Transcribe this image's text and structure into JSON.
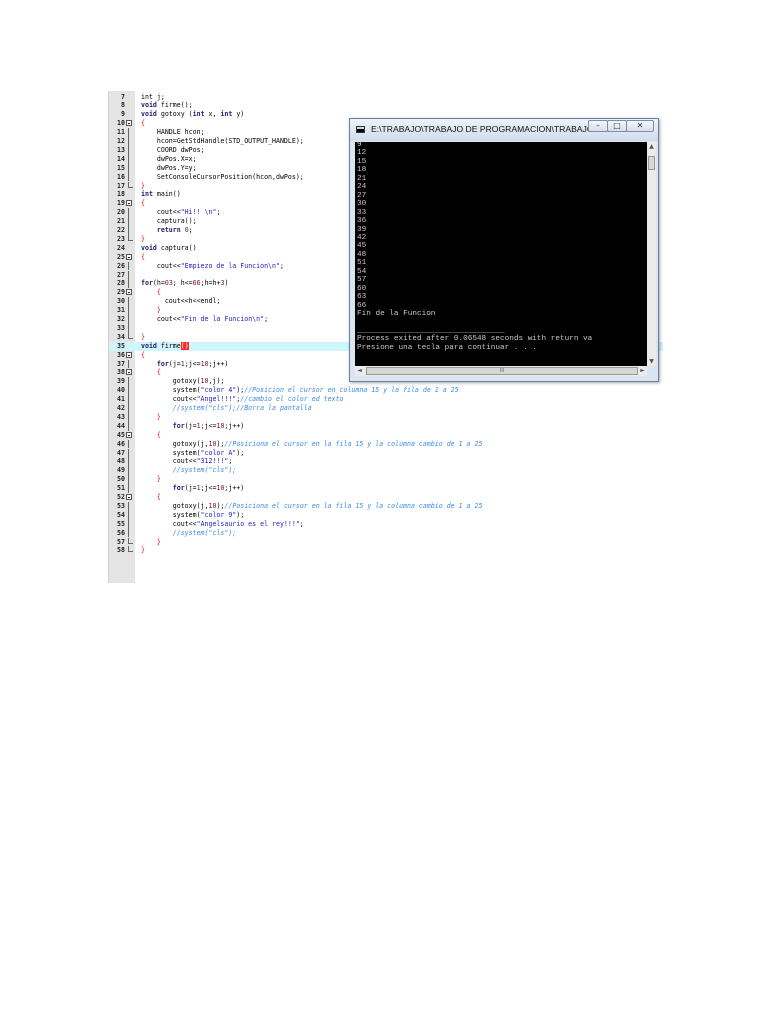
{
  "editor": {
    "lines": [
      {
        "n": "7",
        "g": "",
        "hl": false,
        "t": [
          [
            "n",
            "int j;"
          ]
        ]
      },
      {
        "n": "8",
        "g": "",
        "hl": false,
        "t": [
          [
            "k",
            "void"
          ],
          [
            "n",
            " firme();"
          ]
        ]
      },
      {
        "n": "9",
        "g": "",
        "hl": false,
        "t": [
          [
            "k",
            "void"
          ],
          [
            "n",
            " gotoxy ("
          ],
          [
            "k",
            "int"
          ],
          [
            "n",
            " x, "
          ],
          [
            "k",
            "int"
          ],
          [
            "n",
            " y)"
          ]
        ]
      },
      {
        "n": "10",
        "g": "f",
        "hl": false,
        "t": [
          [
            "r",
            "{"
          ]
        ]
      },
      {
        "n": "11",
        "g": "l",
        "hl": false,
        "t": [
          [
            "n",
            "    HANDLE hcon;"
          ]
        ]
      },
      {
        "n": "12",
        "g": "l",
        "hl": false,
        "t": [
          [
            "n",
            "    hcon=GetStdHandle(STD_OUTPUT_HANDLE);"
          ]
        ]
      },
      {
        "n": "13",
        "g": "l",
        "hl": false,
        "t": [
          [
            "n",
            "    COORD dwPos;"
          ]
        ]
      },
      {
        "n": "14",
        "g": "l",
        "hl": false,
        "t": [
          [
            "n",
            "    dwPos.X=x;"
          ]
        ]
      },
      {
        "n": "15",
        "g": "l",
        "hl": false,
        "t": [
          [
            "n",
            "    dwPos.Y=y;"
          ]
        ]
      },
      {
        "n": "16",
        "g": "l",
        "hl": false,
        "t": [
          [
            "n",
            "    SetConsoleCursorPosition(hcon,dwPos);"
          ]
        ]
      },
      {
        "n": "17",
        "g": "e",
        "hl": false,
        "t": [
          [
            "r",
            "}"
          ]
        ]
      },
      {
        "n": "18",
        "g": "",
        "hl": false,
        "t": [
          [
            "k",
            "int"
          ],
          [
            "n",
            " main()"
          ]
        ]
      },
      {
        "n": "19",
        "g": "f",
        "hl": false,
        "t": [
          [
            "r",
            "{"
          ]
        ]
      },
      {
        "n": "20",
        "g": "l",
        "hl": false,
        "t": [
          [
            "n",
            "    cout<<"
          ],
          [
            "s",
            "\"Hi!! \\n\""
          ],
          [
            "n",
            ";"
          ]
        ]
      },
      {
        "n": "21",
        "g": "l",
        "hl": false,
        "t": [
          [
            "n",
            "    captura();"
          ]
        ]
      },
      {
        "n": "22",
        "g": "l",
        "hl": false,
        "t": [
          [
            "k",
            "    return"
          ],
          [
            "n",
            " "
          ],
          [
            "m",
            "0"
          ],
          [
            "n",
            ";"
          ]
        ]
      },
      {
        "n": "23",
        "g": "e",
        "hl": false,
        "t": [
          [
            "r",
            "}"
          ]
        ]
      },
      {
        "n": "24",
        "g": "",
        "hl": false,
        "t": [
          [
            "k",
            "void"
          ],
          [
            "n",
            " captura()"
          ]
        ]
      },
      {
        "n": "25",
        "g": "f",
        "hl": false,
        "t": [
          [
            "r",
            "{"
          ]
        ]
      },
      {
        "n": "26",
        "g": "l",
        "hl": false,
        "t": [
          [
            "n",
            "    cout<<"
          ],
          [
            "s",
            "\"Empiezo de la Funcion\\n\""
          ],
          [
            "n",
            ";"
          ]
        ]
      },
      {
        "n": "27",
        "g": "l",
        "hl": false,
        "t": [
          [
            "n",
            ""
          ]
        ]
      },
      {
        "n": "28",
        "g": "l",
        "hl": false,
        "t": [
          [
            "k",
            "for"
          ],
          [
            "n",
            "(h="
          ],
          [
            "m",
            "03"
          ],
          [
            "n",
            "; h<="
          ],
          [
            "m",
            "66"
          ],
          [
            "n",
            ";h=h+"
          ],
          [
            "m",
            "3"
          ],
          [
            "n",
            ")"
          ]
        ]
      },
      {
        "n": "29",
        "g": "f",
        "hl": false,
        "t": [
          [
            "n",
            "    "
          ],
          [
            "r",
            "{"
          ]
        ]
      },
      {
        "n": "30",
        "g": "l",
        "hl": false,
        "t": [
          [
            "n",
            "      cout<<h<<endl;"
          ]
        ]
      },
      {
        "n": "31",
        "g": "l",
        "hl": false,
        "t": [
          [
            "n",
            "    "
          ],
          [
            "r",
            "}"
          ]
        ]
      },
      {
        "n": "32",
        "g": "l",
        "hl": false,
        "t": [
          [
            "n",
            "    cout<<"
          ],
          [
            "s",
            "\"Fin de la Funcion\\n\""
          ],
          [
            "n",
            ";"
          ]
        ]
      },
      {
        "n": "33",
        "g": "l",
        "hl": false,
        "t": [
          [
            "n",
            ""
          ]
        ]
      },
      {
        "n": "34",
        "g": "e",
        "hl": false,
        "t": [
          [
            "r",
            "}"
          ]
        ]
      },
      {
        "n": "35",
        "g": "",
        "hl": true,
        "t": [
          [
            "k",
            "void"
          ],
          [
            "n",
            " firme"
          ],
          [
            "sel",
            "()"
          ]
        ]
      },
      {
        "n": "36",
        "g": "f",
        "hl": false,
        "t": [
          [
            "r",
            "{"
          ]
        ]
      },
      {
        "n": "37",
        "g": "l",
        "hl": false,
        "t": [
          [
            "k",
            "    for"
          ],
          [
            "n",
            "(j="
          ],
          [
            "m",
            "1"
          ],
          [
            "n",
            ";j<="
          ],
          [
            "m",
            "10"
          ],
          [
            "n",
            ";j++)"
          ]
        ]
      },
      {
        "n": "38",
        "g": "f",
        "hl": false,
        "t": [
          [
            "n",
            "    "
          ],
          [
            "r",
            "{"
          ]
        ]
      },
      {
        "n": "39",
        "g": "l",
        "hl": false,
        "t": [
          [
            "n",
            "        gotoxy("
          ],
          [
            "m",
            "10"
          ],
          [
            "n",
            ",j);"
          ]
        ]
      },
      {
        "n": "40",
        "g": "l",
        "hl": false,
        "t": [
          [
            "n",
            "        system("
          ],
          [
            "s",
            "\"color 4\""
          ],
          [
            "n",
            ");"
          ],
          [
            "c",
            "//Posicion el cursor en columna 15 y la fila de 1 a 25"
          ]
        ]
      },
      {
        "n": "41",
        "g": "l",
        "hl": false,
        "t": [
          [
            "n",
            "        cout<<"
          ],
          [
            "s",
            "\"Angel!!!\""
          ],
          [
            "n",
            ";"
          ],
          [
            "c",
            "//cambio el color ed texto"
          ]
        ]
      },
      {
        "n": "42",
        "g": "l",
        "hl": false,
        "t": [
          [
            "c",
            "        //system(\"cls\");//Borra la pantalla"
          ]
        ]
      },
      {
        "n": "43",
        "g": "l",
        "hl": false,
        "t": [
          [
            "n",
            "    "
          ],
          [
            "r",
            "}"
          ]
        ]
      },
      {
        "n": "44",
        "g": "l",
        "hl": false,
        "t": [
          [
            "k",
            "        for"
          ],
          [
            "n",
            "(j="
          ],
          [
            "m",
            "1"
          ],
          [
            "n",
            ";j<="
          ],
          [
            "m",
            "10"
          ],
          [
            "n",
            ";j++)"
          ]
        ]
      },
      {
        "n": "45",
        "g": "f",
        "hl": false,
        "t": [
          [
            "n",
            "    "
          ],
          [
            "r",
            "{"
          ]
        ]
      },
      {
        "n": "46",
        "g": "l",
        "hl": false,
        "t": [
          [
            "n",
            "        gotoxy(j,"
          ],
          [
            "m",
            "10"
          ],
          [
            "n",
            ");"
          ],
          [
            "c",
            "//Posiciona el cursor en la fila 15 y la columna cambio de 1 a 25"
          ]
        ]
      },
      {
        "n": "47",
        "g": "l",
        "hl": false,
        "t": [
          [
            "n",
            "        system("
          ],
          [
            "s",
            "\"color A\""
          ],
          [
            "n",
            ");"
          ]
        ]
      },
      {
        "n": "48",
        "g": "l",
        "hl": false,
        "t": [
          [
            "n",
            "        cout<<"
          ],
          [
            "s",
            "\"312!!!\""
          ],
          [
            "n",
            ";"
          ]
        ]
      },
      {
        "n": "49",
        "g": "l",
        "hl": false,
        "t": [
          [
            "c",
            "        //system(\"cls\");"
          ]
        ]
      },
      {
        "n": "50",
        "g": "l",
        "hl": false,
        "t": [
          [
            "n",
            "    "
          ],
          [
            "r",
            "}"
          ]
        ]
      },
      {
        "n": "51",
        "g": "l",
        "hl": false,
        "t": [
          [
            "k",
            "        for"
          ],
          [
            "n",
            "(j="
          ],
          [
            "m",
            "1"
          ],
          [
            "n",
            ";j<="
          ],
          [
            "m",
            "10"
          ],
          [
            "n",
            ";j++)"
          ]
        ]
      },
      {
        "n": "52",
        "g": "f",
        "hl": false,
        "t": [
          [
            "n",
            "    "
          ],
          [
            "r",
            "{"
          ]
        ]
      },
      {
        "n": "53",
        "g": "l",
        "hl": false,
        "t": [
          [
            "n",
            "        gotoxy(j,"
          ],
          [
            "m",
            "10"
          ],
          [
            "n",
            ");"
          ],
          [
            "c",
            "//Posiciona el cursor en la fila 15 y la columna cambio de 1 a 25"
          ]
        ]
      },
      {
        "n": "54",
        "g": "l",
        "hl": false,
        "t": [
          [
            "n",
            "        system("
          ],
          [
            "s",
            "\"color 9\""
          ],
          [
            "n",
            ");"
          ]
        ]
      },
      {
        "n": "55",
        "g": "l",
        "hl": false,
        "t": [
          [
            "n",
            "        cout<<"
          ],
          [
            "s",
            "\"Angelsaurio es el rey!!!\""
          ],
          [
            "n",
            ";"
          ]
        ]
      },
      {
        "n": "56",
        "g": "l",
        "hl": false,
        "t": [
          [
            "c",
            "        //system(\"cls\");"
          ]
        ]
      },
      {
        "n": "57",
        "g": "e",
        "hl": false,
        "t": [
          [
            "n",
            "    "
          ],
          [
            "r",
            "}"
          ]
        ]
      },
      {
        "n": "58",
        "g": "e",
        "hl": false,
        "t": [
          [
            "r",
            "}"
          ]
        ]
      }
    ]
  },
  "console": {
    "title": "E:\\TRABAJO\\TRABAJO DE PROGRAMACION\\TRABAJOS...",
    "buttons": {
      "minimize": "–",
      "maximize": "□",
      "close": "✕"
    },
    "lines": [
      "9",
      "12",
      "15",
      "18",
      "21",
      "24",
      "27",
      "30",
      "33",
      "36",
      "39",
      "42",
      "45",
      "48",
      "51",
      "54",
      "57",
      "60",
      "63",
      "66",
      "Fin de la Funcion",
      "",
      "________________________________",
      "Process exited after 0.06548 seconds with return va",
      "Presione una tecla para continuar . . ."
    ],
    "scroll": {
      "up": "▲",
      "down": "▼",
      "left": "◄",
      "right": "►",
      "grip": "III"
    }
  }
}
